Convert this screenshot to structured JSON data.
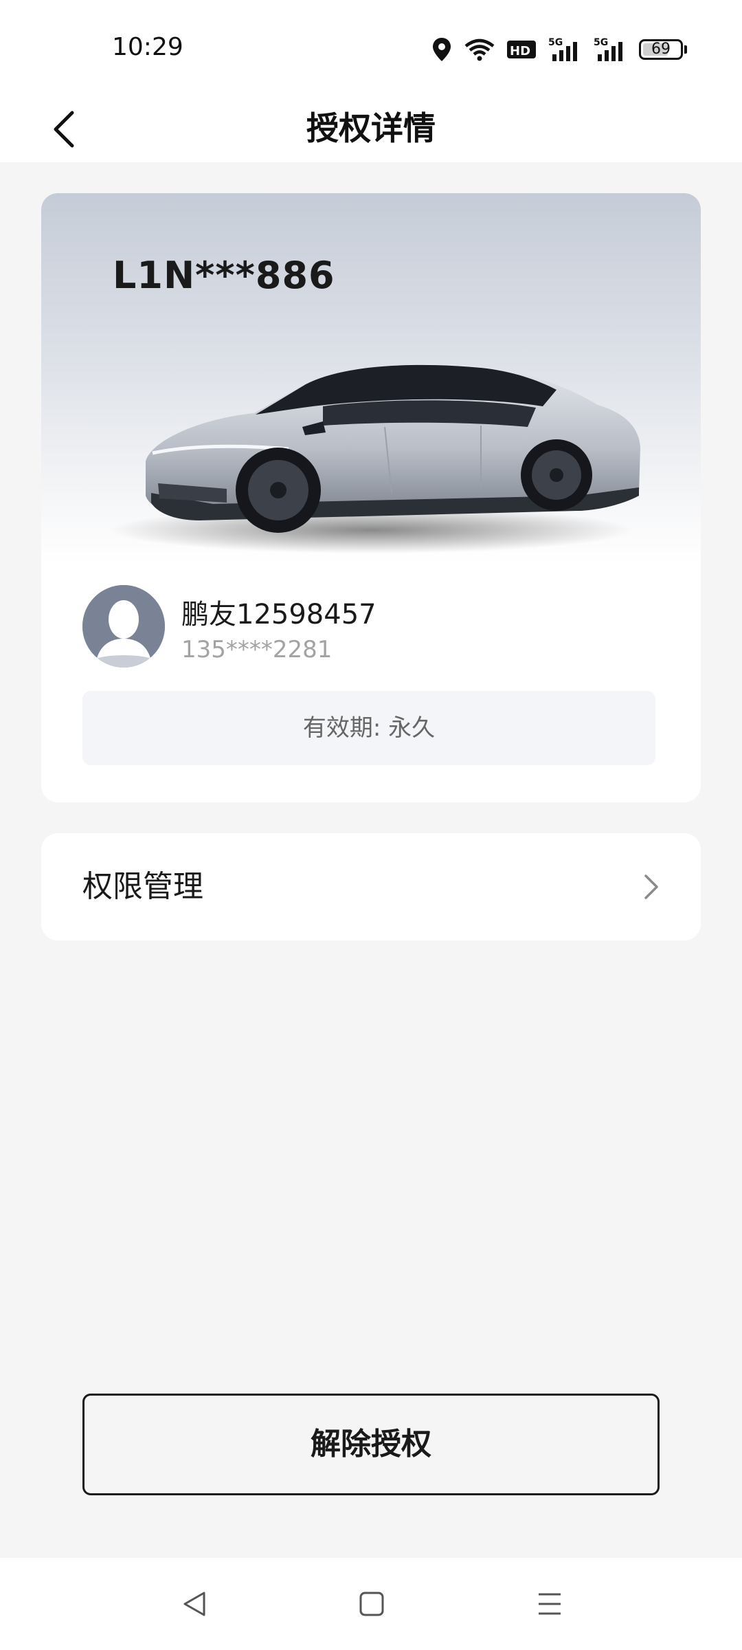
{
  "status_bar": {
    "time": "10:29",
    "network_label_1": "5G",
    "network_label_2": "5G",
    "hd_label": "HD",
    "battery_percent": "69",
    "battery_level": 0.69,
    "icons": [
      "location-icon",
      "wifi-icon",
      "hd-icon",
      "signal-5g-icon",
      "signal-5g-icon",
      "battery-icon"
    ]
  },
  "header": {
    "title": "授权详情",
    "back_icon": "chevron-left-icon"
  },
  "vehicle": {
    "plate": "L1N***886",
    "image": "car-image",
    "card_gradient_top": "#c6ccd7"
  },
  "user": {
    "name": "鹏友12598457",
    "phone": "135****2281",
    "avatar_icon": "default-avatar-icon"
  },
  "validity": {
    "text": "有效期: 永久"
  },
  "permission": {
    "label": "权限管理",
    "icon": "chevron-right-icon"
  },
  "actions": {
    "revoke_label": "解除授权"
  },
  "nav_bar": {
    "icons": [
      "back-triangle-icon",
      "home-square-icon",
      "menu-lines-icon"
    ]
  },
  "colors": {
    "background": "#f5f5f5",
    "card": "#ffffff",
    "text_primary": "#1a1a1a",
    "text_secondary": "#a3a3a3",
    "validity_bg": "#f4f5f8",
    "avatar": "#7a8396"
  }
}
